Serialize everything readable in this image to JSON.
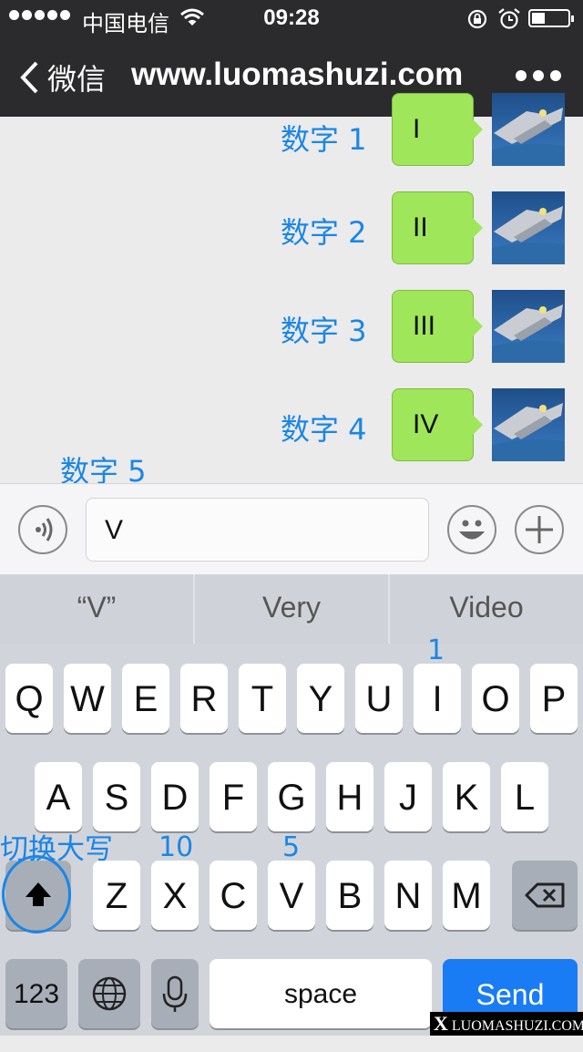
{
  "status_bar": {
    "carrier": "中国电信",
    "time": "09:28"
  },
  "nav": {
    "back_label": "微信",
    "title": "www.luomashuzi.com"
  },
  "messages": [
    {
      "annotation": "数字 1",
      "text": "I"
    },
    {
      "annotation": "数字 2",
      "text": "II"
    },
    {
      "annotation": "数字 3",
      "text": "III"
    },
    {
      "annotation": "数字 4",
      "text": "IV"
    }
  ],
  "pending_annotation": "数字 5",
  "input": {
    "value": "V"
  },
  "suggestions": [
    "“V”",
    "Very",
    "Video"
  ],
  "keyboard": {
    "row1": [
      "Q",
      "W",
      "E",
      "R",
      "T",
      "Y",
      "U",
      "I",
      "O",
      "P"
    ],
    "row2": [
      "A",
      "S",
      "D",
      "F",
      "G",
      "H",
      "J",
      "K",
      "L"
    ],
    "row3": [
      "Z",
      "X",
      "C",
      "V",
      "B",
      "N",
      "M"
    ],
    "numbers_key": "123",
    "space_key": "space",
    "send_key": "Send"
  },
  "key_annotations": {
    "i_key": "1",
    "x_key": "10",
    "v_key": "5",
    "shift": "切换大写"
  },
  "watermark": "LUOMASHUZI.COM",
  "colors": {
    "annotation": "#1a86e6",
    "bubble": "#9fe65a",
    "send": "#1a7cf5",
    "nav_bg": "#2b2b2d"
  }
}
